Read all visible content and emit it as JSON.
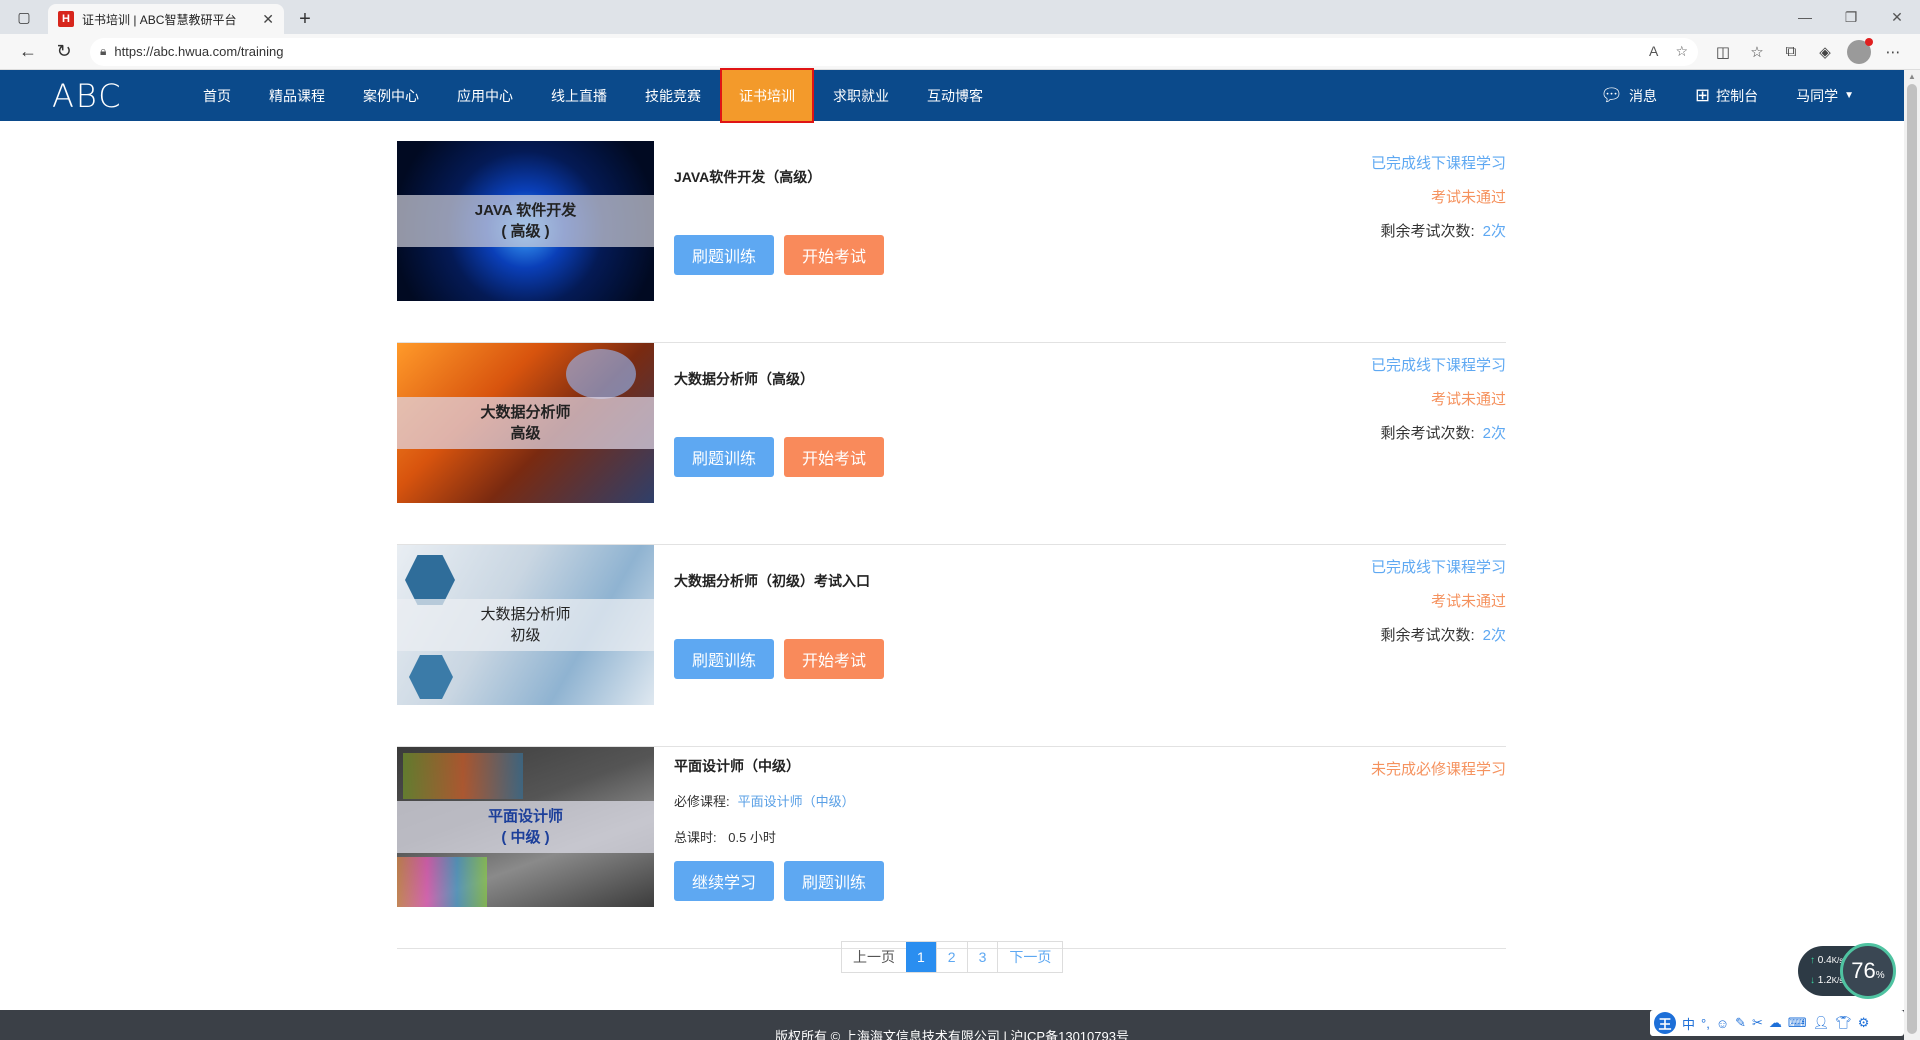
{
  "browser": {
    "tab_title": "证书培训 | ABC智慧教研平台",
    "favicon_letter": "H",
    "url": "https://abc.hwua.com/training"
  },
  "site": {
    "logo": "ABC",
    "menu": [
      "首页",
      "精品课程",
      "案例中心",
      "应用中心",
      "线上直播",
      "技能竞赛",
      "证书培训",
      "求职就业",
      "互动博客"
    ],
    "active_menu": "证书培训",
    "nav_right": {
      "messages": "消息",
      "console": "控制台",
      "user": "马同学"
    }
  },
  "courses": [
    {
      "thumb_line1": "JAVA 软件开发",
      "thumb_line2": "( 高级 )",
      "title": "JAVA软件开发（高级）",
      "btn1": "刷题训练",
      "btn2": "开始考试",
      "status1": "已完成线下课程学习",
      "status2": "考试未通过",
      "remain_label": "剩余考试次数:",
      "remain_value": "2次"
    },
    {
      "thumb_line1": "大数据分析师",
      "thumb_line2": "高级",
      "title": "大数据分析师（高级）",
      "btn1": "刷题训练",
      "btn2": "开始考试",
      "status1": "已完成线下课程学习",
      "status2": "考试未通过",
      "remain_label": "剩余考试次数:",
      "remain_value": "2次"
    },
    {
      "thumb_line1": "大数据分析师",
      "thumb_line2": "初级",
      "title": "大数据分析师（初级）考试入口",
      "btn1": "刷题训练",
      "btn2": "开始考试",
      "status1": "已完成线下课程学习",
      "status2": "考试未通过",
      "remain_label": "剩余考试次数:",
      "remain_value": "2次"
    },
    {
      "thumb_line1": "平面设计师",
      "thumb_line2": "( 中级 )",
      "title": "平面设计师（中级）",
      "required_label": "必修课程:",
      "required_link": "平面设计师（中级）",
      "hours_label": "总课时:",
      "hours_value": "0.5 小时",
      "btn1": "继续学习",
      "btn2": "刷题训练",
      "status1": "未完成必修课程学习"
    }
  ],
  "pagination": {
    "prev": "上一页",
    "pages": [
      "1",
      "2",
      "3"
    ],
    "current": "1",
    "next": "下一页"
  },
  "footer": "版权所有 © 上海海文信息技术有限公司 | 沪ICP备13010793号",
  "net_widget": {
    "up": "0.4",
    "down": "1.2",
    "unit": "K/s",
    "percent": "76",
    "percent_unit": "%"
  },
  "ime": {
    "logo": "王",
    "mode": "中"
  }
}
